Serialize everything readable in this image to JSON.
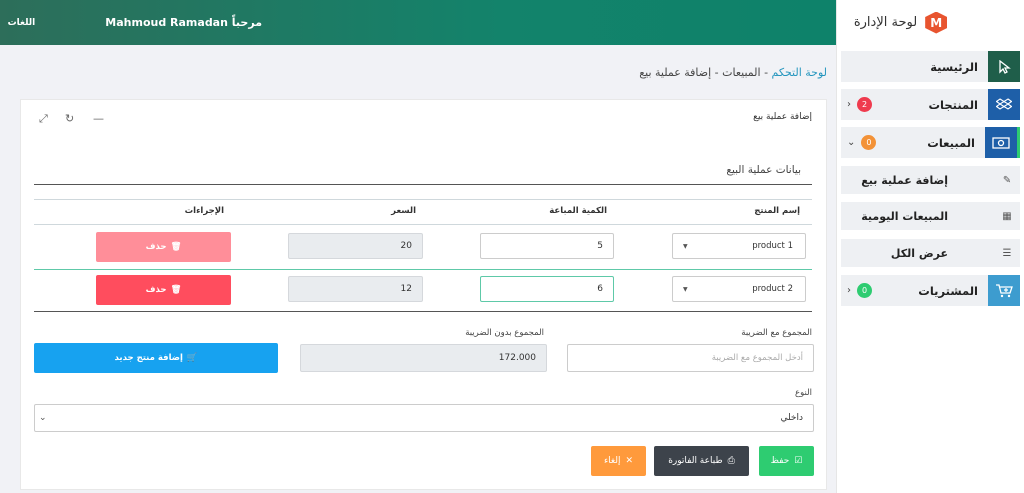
{
  "sidebar": {
    "brand_letter": "M",
    "brand_title": "لوحة الإدارة",
    "items": [
      {
        "label": "الرئيسية"
      },
      {
        "label": "المنتجات",
        "badge": "2"
      },
      {
        "label": "المبيعات",
        "badge": "0"
      },
      {
        "label": "المشتريات",
        "badge": "0"
      }
    ],
    "sub_items": [
      {
        "label": "إضافة عملية بيع"
      },
      {
        "label": "المبيعات اليومية"
      },
      {
        "label": "عرض الكل"
      }
    ]
  },
  "topbar": {
    "greeting_prefix": "مرحباً",
    "user_name": "Mahmoud Ramadan",
    "languages": "اللغات"
  },
  "breadcrumb": {
    "home": "لوحة التحكم",
    "sep1": " - ",
    "sales": "المبيعات",
    "sep2": " - ",
    "current": "إضافة عملية بيع"
  },
  "card": {
    "title": "إضافة عملية بيع",
    "section_title": "بيانات عملية البيع"
  },
  "table": {
    "headers": {
      "product": "إسم المنتج",
      "qty": "الكمية المباعة",
      "price": "السعر",
      "actions": "الإجراءات"
    },
    "rows": [
      {
        "product": "product 1",
        "qty": "5",
        "price": "20",
        "delete": "حذف"
      },
      {
        "product": "product 2",
        "qty": "6",
        "price": "12",
        "delete": "حذف"
      }
    ]
  },
  "totals": {
    "with_tax_label": "المجموع مع الضريبة",
    "with_tax_placeholder": "أدخل المجموع مع الضريبة",
    "without_tax_label": "المجموع بدون الضريبة",
    "without_tax_value": "172.000",
    "add_product": "إضافة منتج جديد"
  },
  "type": {
    "label": "النوع",
    "value": "داخلي"
  },
  "footer": {
    "save": "حفظ",
    "print": "طباعة الفاتورة",
    "cancel": "إلغاء"
  },
  "colors": {
    "topbar": "#13836b",
    "accent_green": "#2ecc71",
    "danger": "#ff4d5e",
    "info": "#17a2f0",
    "warning": "#ff9a3c",
    "dark": "#3d434b"
  }
}
